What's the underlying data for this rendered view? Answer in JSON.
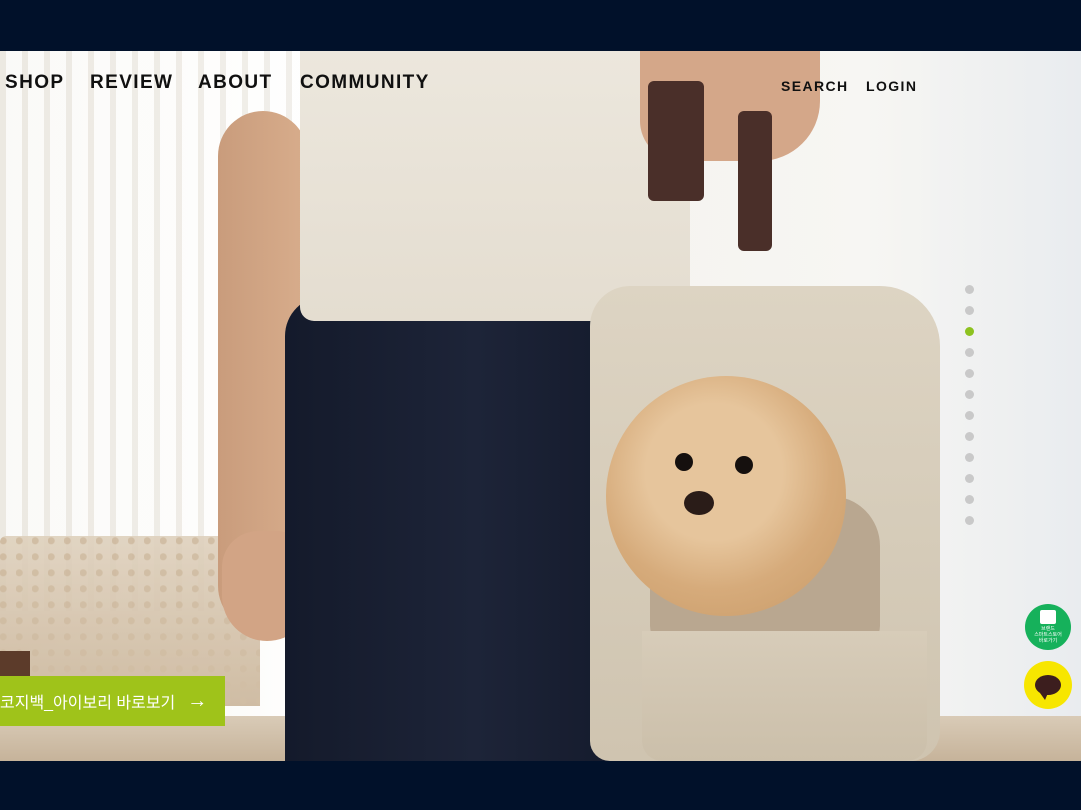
{
  "nav": {
    "links": [
      "SHOP",
      "REVIEW",
      "ABOUT",
      "COMMUNITY"
    ],
    "utility": [
      "SEARCH",
      "LOGIN"
    ]
  },
  "slider": {
    "total": 12,
    "active": 3,
    "active_color": "#8dc21f"
  },
  "cta": {
    "label": "코지백_아이보리 바로보기",
    "arrow": "→",
    "color": "#9fc31a"
  },
  "floating": {
    "store": {
      "lines": [
        "브랜드",
        "스마트스토어",
        "바로가기"
      ],
      "color": "#16b15b",
      "icon": "store-icon"
    },
    "talk": {
      "color": "#f7e600",
      "icon": "chat-bubble-icon"
    }
  },
  "colors": {
    "band": "#01112a"
  }
}
